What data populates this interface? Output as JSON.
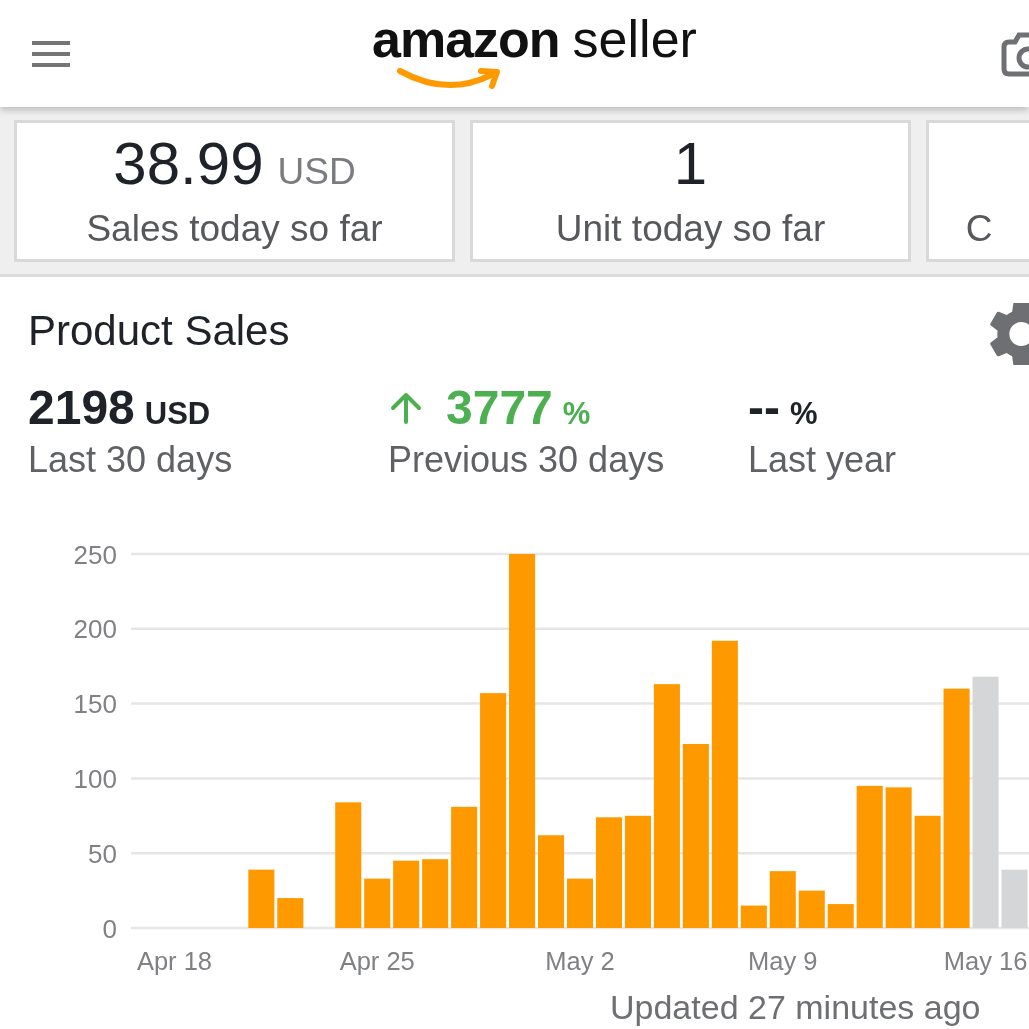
{
  "header": {
    "logo": {
      "brand": "amazon",
      "product": "seller"
    }
  },
  "summary_cards": [
    {
      "value": "38.99",
      "unit": "USD",
      "label": "Sales today so far"
    },
    {
      "value": "1",
      "label": "Unit today so far"
    },
    {
      "label": "C"
    }
  ],
  "product_sales": {
    "title": "Product Sales",
    "stats": [
      {
        "increase": false,
        "value": "2198",
        "unit": "USD",
        "label": "Last 30 days"
      },
      {
        "increase": true,
        "value": "3777",
        "unit": "%",
        "label": "Previous 30 days"
      },
      {
        "increase": false,
        "value": "--",
        "unit": "%",
        "label": "Last year"
      }
    ],
    "chart_data": {
      "type": "bar",
      "categories": [
        null,
        "Apr 18",
        null,
        null,
        null,
        null,
        null,
        null,
        "Apr 25",
        null,
        null,
        null,
        null,
        null,
        null,
        "May 2",
        null,
        null,
        null,
        null,
        null,
        null,
        "May 9",
        null,
        null,
        null,
        null,
        null,
        null,
        "May 16",
        null
      ],
      "ylim": [
        0,
        250
      ],
      "yticks": [
        0,
        50,
        100,
        150,
        200,
        250
      ],
      "grid": true,
      "stacked": true,
      "series": [
        {
          "color": "#ff9900",
          "values": [
            null,
            null,
            null,
            null,
            39,
            20,
            null,
            84,
            33,
            45,
            46,
            81,
            157,
            250,
            62,
            33,
            74,
            75,
            163,
            123,
            192,
            15,
            38,
            25,
            16,
            95,
            94,
            75,
            160,
            null,
            null
          ]
        },
        {
          "color": "#d5d6d8",
          "values": [
            null,
            null,
            null,
            null,
            null,
            null,
            null,
            null,
            null,
            null,
            null,
            null,
            null,
            null,
            null,
            null,
            null,
            null,
            null,
            null,
            null,
            null,
            null,
            null,
            null,
            null,
            null,
            null,
            null,
            168,
            39
          ]
        }
      ]
    },
    "updated": "Updated 27 minutes ago"
  }
}
